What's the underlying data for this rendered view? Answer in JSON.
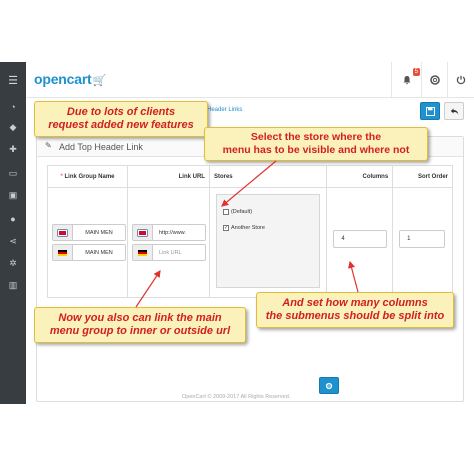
{
  "header": {
    "logo_text": "opencart",
    "logo_cart_icon": "cart-icon",
    "notification_count": "5",
    "icons": [
      "bell-icon",
      "life-ring-icon",
      "logout-icon"
    ]
  },
  "sidebar": {
    "icons": [
      "dashboard-icon",
      "tags-icon",
      "puzzle-icon",
      "desktop-icon",
      "cart-icon",
      "user-icon",
      "share-icon",
      "gear-icon",
      "bar-chart-icon"
    ]
  },
  "breadcrumb": {
    "text": "p Header Links"
  },
  "toolbar": {
    "save_icon": "save-icon",
    "back_icon": "reply-icon"
  },
  "panel": {
    "title": "Add Top Header Link"
  },
  "table": {
    "headers": {
      "link_group_name": "Link Group Name",
      "link_url": "Link URL",
      "stores": "Stores",
      "columns": "Columns",
      "sort_order": "Sort Order"
    },
    "group_names": [
      "MAIN MEN",
      "MAIN MEN"
    ],
    "url_values": [
      "http://www.",
      ""
    ],
    "url_placeholder": "Link URL",
    "stores": [
      {
        "label": "(Default)",
        "checked": false
      },
      {
        "label": "Another Store",
        "checked": true
      }
    ],
    "columns_value": "4",
    "sort_order_value": "1"
  },
  "footer": {
    "text": "OpenCart © 2009-2017 All Rights Reserved."
  },
  "callouts": {
    "top_left": [
      "Due to lots of clients",
      "request added new features"
    ],
    "stores": [
      "Select the store where the",
      "menu has to be visible and where not"
    ],
    "url": [
      "Now you also can link the main",
      "menu group to inner or outside url"
    ],
    "columns": [
      "And set how many columns",
      "the submenus should be split into"
    ]
  },
  "colors": {
    "sidebar": "#383d41",
    "primary": "#1e91cf",
    "callout_bg": "#fbf1ba",
    "callout_text": "#d21f1f"
  }
}
